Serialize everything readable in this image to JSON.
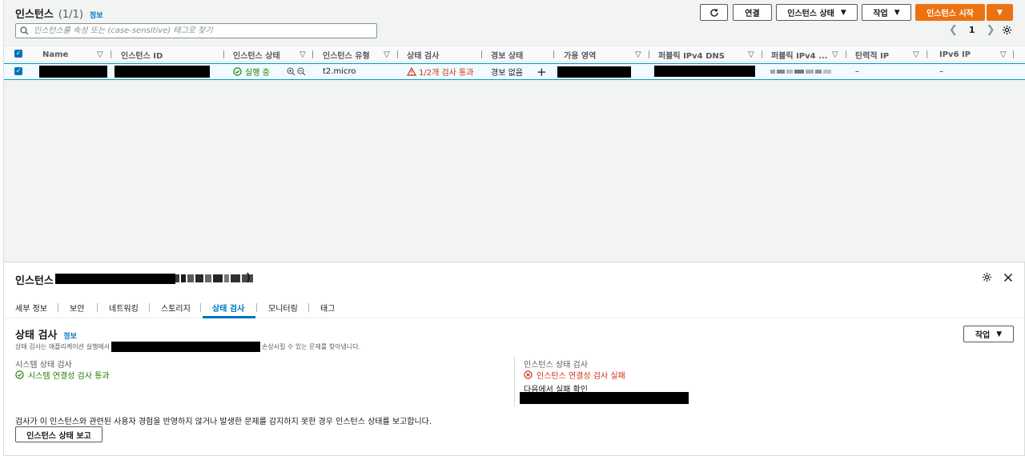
{
  "header": {
    "title": "인스턴스",
    "count": "(1/1)",
    "info": "정보"
  },
  "toolbar": {
    "connect": "연결",
    "instance_state": "인스턴스 상태",
    "actions": "작업",
    "launch": "인스턴스 시작"
  },
  "search": {
    "placeholder": "인스턴스를 속성 또는 (case-sensitive) 태그로 찾기"
  },
  "pagination": {
    "page": "1"
  },
  "table": {
    "columns": [
      "Name",
      "인스턴스 ID",
      "인스턴스 상태",
      "인스턴스 유형",
      "상태 검사",
      "경보 상태",
      "가용 영역",
      "퍼블릭 IPv4 DNS",
      "퍼블릭 IPv4 ...",
      "탄력적 IP",
      "IPv6 IP"
    ],
    "row": {
      "state": "실행 중",
      "type": "t2.micro",
      "status_check": "1/2개 검사 통과",
      "alarm": "경보 없음",
      "elastic_ip": "–",
      "ipv6": "–"
    }
  },
  "detail": {
    "title_prefix": "인스턴스",
    "title_suffix": ")",
    "tabs": [
      "세부 정보",
      "보안",
      "네트워킹",
      "스토리지",
      "상태 검사",
      "모니터링",
      "태그"
    ],
    "active_tab": "상태 검사",
    "section_title": "상태 검사",
    "section_info": "정보",
    "actions": "작업",
    "desc_prefix": "상태 검사는 애플리케이션 실행에서",
    "desc_suffix": "손상시킬 수 있는 문제를 찾아냅니다.",
    "system_check_label": "시스템 상태 검사",
    "system_check_value": "시스템 연결성 검사 통과",
    "instance_check_label": "인스턴스 상태 검사",
    "instance_check_value": "인스턴스 연결성 검사 실패",
    "failure_check_label": "다음에서 실패 확인",
    "footer_text": "검사가 이 인스턴스와 관련된 사용자 경험을 반영하지 않거나 발생한 문제를 감지하지 못한 경우 인스턴스 상태를 보고합니다.",
    "report_button": "인스턴스 상태 보고"
  },
  "colors": {
    "primary": "#ec7211",
    "link": "#0073bb",
    "success": "#1d8102",
    "error": "#d13212"
  }
}
